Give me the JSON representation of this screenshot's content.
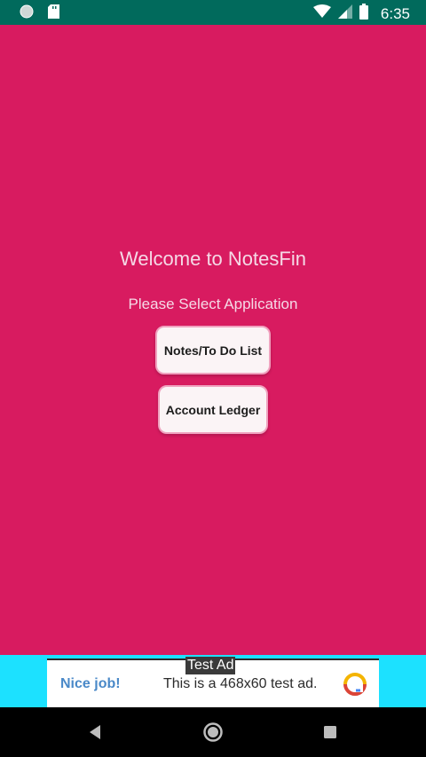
{
  "status_bar": {
    "time": "6:35",
    "icons": [
      "circle-notification-icon",
      "sd-card-icon",
      "wifi-icon",
      "signal-icon",
      "battery-icon"
    ]
  },
  "main": {
    "welcome_text": "Welcome to NotesFin",
    "select_label": "Please Select Application",
    "buttons": [
      {
        "label": "Notes/To Do List"
      },
      {
        "label": "Account Ledger"
      }
    ]
  },
  "ad": {
    "label": "Test Ad",
    "nice": "Nice job!",
    "text": "This is a 468x60 test ad.",
    "logo_icon": "ad-choices-logo-icon"
  },
  "nav_bar": {
    "icons": [
      "back-icon",
      "home-icon",
      "recents-icon"
    ]
  },
  "colors": {
    "background": "#d81b60",
    "status_bar": "#016a5c",
    "ad_background": "#1ce1ff",
    "button_fill": "#fbf4f6",
    "button_border": "#f0a2bf"
  }
}
